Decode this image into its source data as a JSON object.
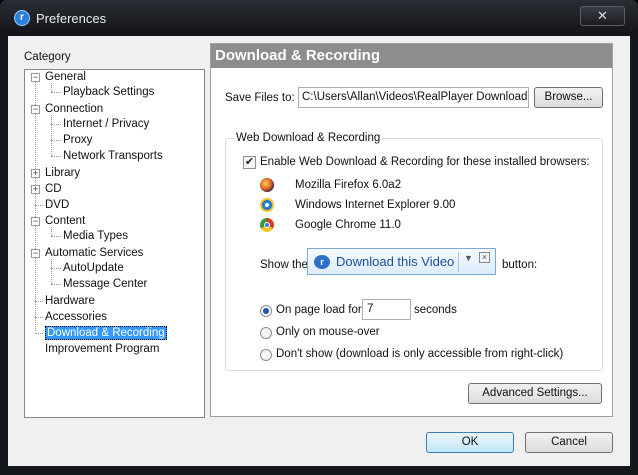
{
  "window": {
    "title": "Preferences",
    "close_glyph": "✕"
  },
  "category": {
    "label": "Category",
    "items": [
      {
        "label": "General",
        "level": 0,
        "expander": "−"
      },
      {
        "label": "Playback Settings",
        "level": 1
      },
      {
        "label": "Connection",
        "level": 0,
        "expander": "−"
      },
      {
        "label": "Internet / Privacy",
        "level": 1
      },
      {
        "label": "Proxy",
        "level": 1
      },
      {
        "label": "Network Transports",
        "level": 1
      },
      {
        "label": "Library",
        "level": 0,
        "expander": "+"
      },
      {
        "label": "CD",
        "level": 0,
        "expander": "+"
      },
      {
        "label": "DVD",
        "level": 0
      },
      {
        "label": "Content",
        "level": 0,
        "expander": "−"
      },
      {
        "label": "Media Types",
        "level": 1
      },
      {
        "label": "Automatic Services",
        "level": 0,
        "expander": "−"
      },
      {
        "label": "AutoUpdate",
        "level": 1
      },
      {
        "label": "Message Center",
        "level": 1
      },
      {
        "label": "Hardware",
        "level": 0
      },
      {
        "label": "Accessories",
        "level": 0
      },
      {
        "label": "Download & Recording",
        "level": 0,
        "selected": true
      },
      {
        "label": "Improvement Program",
        "level": 0
      }
    ]
  },
  "panel": {
    "title": "Download & Recording",
    "save_files_label": "Save Files to:",
    "save_path": "C:\\Users\\Allan\\Videos\\RealPlayer Downloads\\",
    "browse_label": "Browse...",
    "group_title": "Web Download & Recording",
    "enable_checkbox_label": "Enable Web Download & Recording for these installed browsers:",
    "enable_checked": true,
    "browsers": [
      {
        "name": "Mozilla Firefox 6.0a2",
        "icon": "firefox-icon"
      },
      {
        "name": "Windows Internet Explorer 9.00",
        "icon": "internet-explorer-icon"
      },
      {
        "name": "Google Chrome 11.0",
        "icon": "chrome-icon"
      }
    ],
    "show_the_label": "Show the",
    "download_button_text": "Download this Video",
    "button_suffix_label": "button:",
    "radio_options": [
      {
        "label": "On page load for",
        "selected": true
      },
      {
        "label": "Only on mouse-over",
        "selected": false
      },
      {
        "label": "Don't show (download is only accessible from right-click)",
        "selected": false
      }
    ],
    "seconds_value": "7",
    "seconds_label": "seconds",
    "advanced_settings_label": "Advanced Settings..."
  },
  "footer": {
    "ok_label": "OK",
    "cancel_label": "Cancel"
  },
  "colors": {
    "selection": "#3399ff",
    "header": "#8d8d8d",
    "accent": "#2c7fd6"
  }
}
